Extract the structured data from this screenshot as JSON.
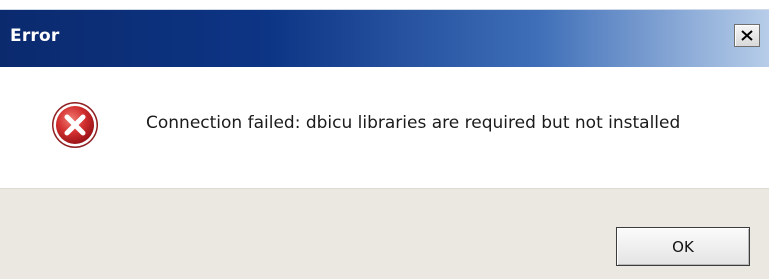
{
  "window": {
    "title": "Error",
    "close_icon": "close-icon"
  },
  "message": {
    "icon": "error-icon",
    "text": "Connection failed: dbicu libraries are required but not installed"
  },
  "buttons": {
    "ok_label": "OK"
  },
  "colors": {
    "titlebar_start": "#0b2a6e",
    "titlebar_end": "#b7cde9",
    "error_red": "#c8282e",
    "footer_bg": "#ebe8e2"
  }
}
